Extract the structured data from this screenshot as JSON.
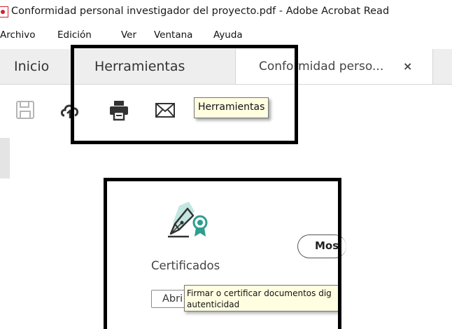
{
  "window": {
    "title": "Conformidad personal investigador del proyecto.pdf - Adobe Acrobat Read",
    "icon": "pdf-icon"
  },
  "menu": {
    "items": [
      "Archivo",
      "Edición",
      "Ver",
      "Ventana",
      "Ayuda"
    ]
  },
  "tabs": {
    "home_label": "Inicio",
    "tools_label": "Herramientas",
    "document_label": "Conformidad perso...",
    "close_glyph": "×"
  },
  "toolbar": {
    "icons": [
      "save-icon",
      "cloud-upload-icon",
      "print-icon",
      "email-icon",
      "search-icon"
    ],
    "tooltip": "Herramientas"
  },
  "tool_card": {
    "icon": "certificate-pen-icon",
    "label": "Certificados",
    "more_button_label": "Mos",
    "open_button_label": "Abri",
    "tooltip_line1": "Firmar o certificar documentos dig",
    "tooltip_line2": "autenticidad"
  },
  "colors": {
    "highlight_border": "#000000",
    "tooltip_bg": "#fffee1",
    "tab_inactive_bg": "#eeeeee",
    "pdf_red": "#d1242f",
    "certificate_teal": "#2e9e8e"
  }
}
